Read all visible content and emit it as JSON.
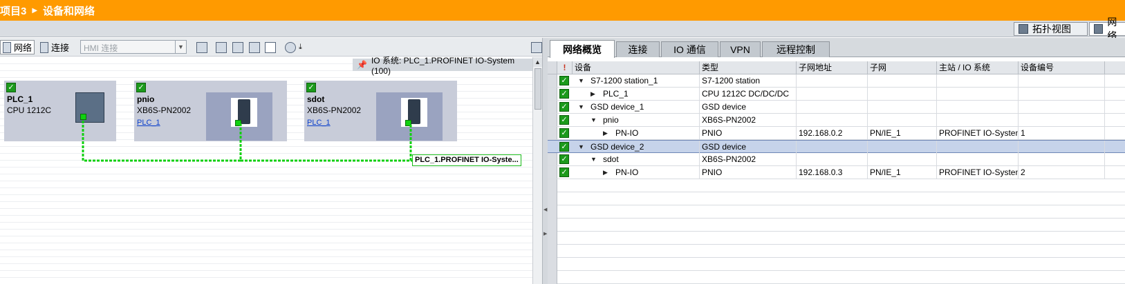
{
  "titlebar": {
    "project": "项目3",
    "page": "设备和网络"
  },
  "viewbar": {
    "topology": "拓扑视图",
    "network": "网络"
  },
  "toolbar": {
    "network": "网络",
    "connections": "连接",
    "hmi_connection": "HMI 连接"
  },
  "canvas": {
    "io_system_label": "IO 系统: PLC_1.PROFINET IO-System (100)",
    "network_label": "PLC_1.PROFINET IO-Syste...",
    "devices": [
      {
        "name": "PLC_1",
        "type": "CPU 1212C",
        "link": ""
      },
      {
        "name": "pnio",
        "type": "XB6S-PN2002",
        "link": "PLC_1"
      },
      {
        "name": "sdot",
        "type": "XB6S-PN2002",
        "link": "PLC_1"
      }
    ]
  },
  "tabs": [
    "网络概览",
    "连接",
    "IO 通信",
    "VPN",
    "远程控制"
  ],
  "grid": {
    "headers": [
      "设备",
      "类型",
      "子网地址",
      "子网",
      "主站 / IO 系统",
      "设备编号"
    ],
    "rows": [
      {
        "device": "S7-1200 station_1",
        "type": "S7-1200 station",
        "address": "",
        "subnet": "",
        "master": "",
        "number": ""
      },
      {
        "device": "PLC_1",
        "type": "CPU 1212C DC/DC/DC",
        "address": "",
        "subnet": "",
        "master": "",
        "number": ""
      },
      {
        "device": "GSD device_1",
        "type": "GSD device",
        "address": "",
        "subnet": "",
        "master": "",
        "number": ""
      },
      {
        "device": "pnio",
        "type": "XB6S-PN2002",
        "address": "",
        "subnet": "",
        "master": "",
        "number": ""
      },
      {
        "device": "PN-IO",
        "type": "PNIO",
        "address": "192.168.0.2",
        "subnet": "PN/IE_1",
        "master": "PROFINET IO-System",
        "number": "1"
      },
      {
        "device": "GSD device_2",
        "type": "GSD device",
        "address": "",
        "subnet": "",
        "master": "",
        "number": ""
      },
      {
        "device": "sdot",
        "type": "XB6S-PN2002",
        "address": "",
        "subnet": "",
        "master": "",
        "number": ""
      },
      {
        "device": "PN-IO",
        "type": "PNIO",
        "address": "192.168.0.3",
        "subnet": "PN/IE_1",
        "master": "PROFINET IO-System",
        "number": "2"
      }
    ]
  },
  "colors": {
    "titlebar": "#ff9a00",
    "status_ok": "#1c9a1c",
    "network_line": "#11d011",
    "selected_row": "#c6d3ea"
  }
}
